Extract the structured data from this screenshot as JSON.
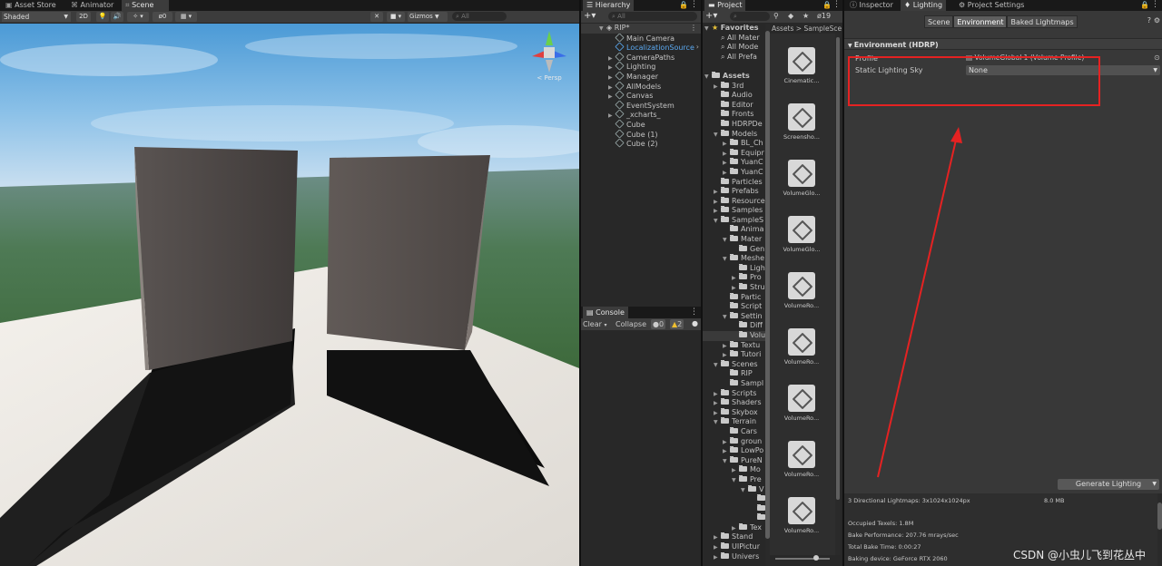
{
  "scene_view": {
    "tabs": [
      "Asset Store",
      "Animator",
      "Scene"
    ],
    "shading_mode": "Shaded",
    "toggle_2d": "2D",
    "hidden_count": "0",
    "gizmos_label": "Gizmos",
    "search_placeholder": "All",
    "persp_label": "< Persp"
  },
  "hierarchy": {
    "tab": "Hierarchy",
    "search_placeholder": "All",
    "scene_name": "RIP*",
    "items": [
      "Main Camera",
      "LocalizationSource",
      "CameraPaths",
      "Lighting",
      "Manager",
      "AllModels",
      "Canvas",
      "EventSystem",
      "_xcharts_",
      "Cube",
      "Cube (1)",
      "Cube (2)"
    ]
  },
  "console": {
    "tab": "Console",
    "clear": "Clear",
    "collapse": "Collapse",
    "errors": "0",
    "warnings": "2"
  },
  "project": {
    "tab": "Project",
    "hidden_count": "19",
    "breadcrumb": [
      "Assets",
      "SampleSce"
    ],
    "favorites_label": "Favorites",
    "favorites": [
      "All Mater",
      "All Mode",
      "All Prefa"
    ],
    "assets_label": "Assets",
    "tree": [
      "3rd",
      "Audio",
      "Editor",
      "Fronts",
      "HDRPDe",
      "Models",
      "BL_Ch",
      "Equipr",
      "YuanC",
      "YuanC",
      "Particles",
      "Prefabs",
      "Resource",
      "Samples",
      "SampleS",
      "Anima",
      "Mater",
      "Gen",
      "Meshe",
      "Ligh",
      "Pro",
      "Stru",
      "Partic",
      "Script",
      "Settin",
      "Diff",
      "Volu",
      "Textu",
      "Tutori",
      "Scenes",
      "RIP",
      "Sampl",
      "Scripts",
      "Shaders",
      "Skybox",
      "Terrain",
      "Cars",
      "groun",
      "LowPo",
      "PureN",
      "Mo",
      "Pre",
      "V",
      "",
      "",
      "",
      "Tex",
      "Stand",
      "UIPictur",
      "Univers"
    ],
    "asset_cards": [
      "Cinematic...",
      "Screensho...",
      "VolumeGlo...",
      "VolumeGlo...",
      "VolumeRo...",
      "VolumeRo...",
      "VolumeRo...",
      "VolumeRo...",
      "VolumeRo..."
    ]
  },
  "right_panel": {
    "tabs": [
      "Inspector",
      "Lighting",
      "Project Settings"
    ],
    "subtabs": [
      "Scene",
      "Environment",
      "Baked Lightmaps"
    ],
    "section_title": "Environment (HDRP)",
    "profile_label": "Profile",
    "profile_value": "VolumeGlobal 1 (Volume Profile)",
    "static_sky_label": "Static Lighting Sky",
    "static_sky_value": "None",
    "generate_button": "Generate Lighting",
    "stats": {
      "lightmaps": "3 Directional Lightmaps: 3x1024x1024px",
      "lightmaps_size": "8.0 MB",
      "occupied": "Occupied Texels: 1.8M",
      "performance": "Bake Performance: 207.76 mrays/sec",
      "total_time": "Total Bake Time: 0:00:27",
      "device": "Baking device: GeForce RTX 2060"
    },
    "watermark": "CSDN @小虫儿飞到花丛中"
  },
  "colors": {
    "annotation_red": "#e52222",
    "selection_blue": "#2c5d87",
    "link_blue": "#4aa3ff"
  }
}
